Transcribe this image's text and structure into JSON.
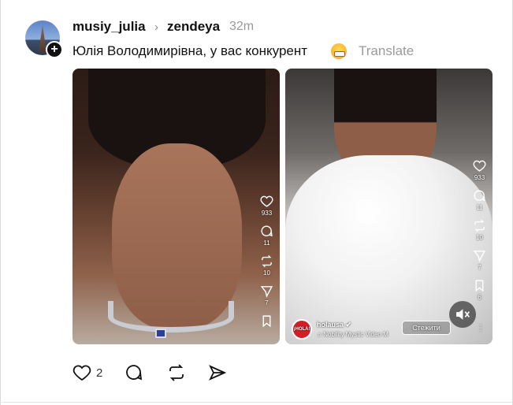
{
  "post": {
    "username": "musiy_julia",
    "reply_arrow": "›",
    "reply_to": "zendeya",
    "time": "32m",
    "caption": "Юлія Володимирівна, у вас конкурент",
    "translate": "Translate"
  },
  "media2": {
    "channel_name": "holausa",
    "logo_text": "¡HOLA!",
    "music_text": "♫ Nobility   Mystic Video M",
    "follow_label": "Стежити",
    "more_label": "⋮"
  },
  "reel_rail": {
    "likes": "933",
    "comments": "11",
    "reposts": "10",
    "shares": "7",
    "saves": "6"
  },
  "actions": {
    "like_count": "2"
  },
  "icons": [
    "heart-icon",
    "comment-icon",
    "repost-icon",
    "send-icon",
    "bookmark-icon",
    "mute-icon",
    "plus-icon",
    "verified-icon"
  ]
}
